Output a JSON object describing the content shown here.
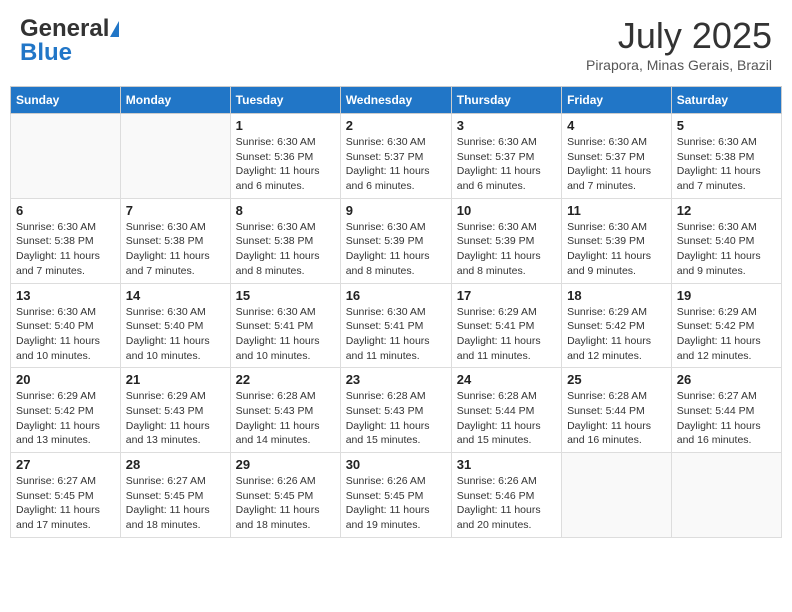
{
  "header": {
    "logo_general": "General",
    "logo_blue": "Blue",
    "month_title": "July 2025",
    "location": "Pirapora, Minas Gerais, Brazil"
  },
  "weekdays": [
    "Sunday",
    "Monday",
    "Tuesday",
    "Wednesday",
    "Thursday",
    "Friday",
    "Saturday"
  ],
  "weeks": [
    [
      {
        "day": "",
        "sunrise": "",
        "sunset": "",
        "daylight": ""
      },
      {
        "day": "",
        "sunrise": "",
        "sunset": "",
        "daylight": ""
      },
      {
        "day": "1",
        "sunrise": "Sunrise: 6:30 AM",
        "sunset": "Sunset: 5:36 PM",
        "daylight": "Daylight: 11 hours and 6 minutes."
      },
      {
        "day": "2",
        "sunrise": "Sunrise: 6:30 AM",
        "sunset": "Sunset: 5:37 PM",
        "daylight": "Daylight: 11 hours and 6 minutes."
      },
      {
        "day": "3",
        "sunrise": "Sunrise: 6:30 AM",
        "sunset": "Sunset: 5:37 PM",
        "daylight": "Daylight: 11 hours and 6 minutes."
      },
      {
        "day": "4",
        "sunrise": "Sunrise: 6:30 AM",
        "sunset": "Sunset: 5:37 PM",
        "daylight": "Daylight: 11 hours and 7 minutes."
      },
      {
        "day": "5",
        "sunrise": "Sunrise: 6:30 AM",
        "sunset": "Sunset: 5:38 PM",
        "daylight": "Daylight: 11 hours and 7 minutes."
      }
    ],
    [
      {
        "day": "6",
        "sunrise": "Sunrise: 6:30 AM",
        "sunset": "Sunset: 5:38 PM",
        "daylight": "Daylight: 11 hours and 7 minutes."
      },
      {
        "day": "7",
        "sunrise": "Sunrise: 6:30 AM",
        "sunset": "Sunset: 5:38 PM",
        "daylight": "Daylight: 11 hours and 7 minutes."
      },
      {
        "day": "8",
        "sunrise": "Sunrise: 6:30 AM",
        "sunset": "Sunset: 5:38 PM",
        "daylight": "Daylight: 11 hours and 8 minutes."
      },
      {
        "day": "9",
        "sunrise": "Sunrise: 6:30 AM",
        "sunset": "Sunset: 5:39 PM",
        "daylight": "Daylight: 11 hours and 8 minutes."
      },
      {
        "day": "10",
        "sunrise": "Sunrise: 6:30 AM",
        "sunset": "Sunset: 5:39 PM",
        "daylight": "Daylight: 11 hours and 8 minutes."
      },
      {
        "day": "11",
        "sunrise": "Sunrise: 6:30 AM",
        "sunset": "Sunset: 5:39 PM",
        "daylight": "Daylight: 11 hours and 9 minutes."
      },
      {
        "day": "12",
        "sunrise": "Sunrise: 6:30 AM",
        "sunset": "Sunset: 5:40 PM",
        "daylight": "Daylight: 11 hours and 9 minutes."
      }
    ],
    [
      {
        "day": "13",
        "sunrise": "Sunrise: 6:30 AM",
        "sunset": "Sunset: 5:40 PM",
        "daylight": "Daylight: 11 hours and 10 minutes."
      },
      {
        "day": "14",
        "sunrise": "Sunrise: 6:30 AM",
        "sunset": "Sunset: 5:40 PM",
        "daylight": "Daylight: 11 hours and 10 minutes."
      },
      {
        "day": "15",
        "sunrise": "Sunrise: 6:30 AM",
        "sunset": "Sunset: 5:41 PM",
        "daylight": "Daylight: 11 hours and 10 minutes."
      },
      {
        "day": "16",
        "sunrise": "Sunrise: 6:30 AM",
        "sunset": "Sunset: 5:41 PM",
        "daylight": "Daylight: 11 hours and 11 minutes."
      },
      {
        "day": "17",
        "sunrise": "Sunrise: 6:29 AM",
        "sunset": "Sunset: 5:41 PM",
        "daylight": "Daylight: 11 hours and 11 minutes."
      },
      {
        "day": "18",
        "sunrise": "Sunrise: 6:29 AM",
        "sunset": "Sunset: 5:42 PM",
        "daylight": "Daylight: 11 hours and 12 minutes."
      },
      {
        "day": "19",
        "sunrise": "Sunrise: 6:29 AM",
        "sunset": "Sunset: 5:42 PM",
        "daylight": "Daylight: 11 hours and 12 minutes."
      }
    ],
    [
      {
        "day": "20",
        "sunrise": "Sunrise: 6:29 AM",
        "sunset": "Sunset: 5:42 PM",
        "daylight": "Daylight: 11 hours and 13 minutes."
      },
      {
        "day": "21",
        "sunrise": "Sunrise: 6:29 AM",
        "sunset": "Sunset: 5:43 PM",
        "daylight": "Daylight: 11 hours and 13 minutes."
      },
      {
        "day": "22",
        "sunrise": "Sunrise: 6:28 AM",
        "sunset": "Sunset: 5:43 PM",
        "daylight": "Daylight: 11 hours and 14 minutes."
      },
      {
        "day": "23",
        "sunrise": "Sunrise: 6:28 AM",
        "sunset": "Sunset: 5:43 PM",
        "daylight": "Daylight: 11 hours and 15 minutes."
      },
      {
        "day": "24",
        "sunrise": "Sunrise: 6:28 AM",
        "sunset": "Sunset: 5:44 PM",
        "daylight": "Daylight: 11 hours and 15 minutes."
      },
      {
        "day": "25",
        "sunrise": "Sunrise: 6:28 AM",
        "sunset": "Sunset: 5:44 PM",
        "daylight": "Daylight: 11 hours and 16 minutes."
      },
      {
        "day": "26",
        "sunrise": "Sunrise: 6:27 AM",
        "sunset": "Sunset: 5:44 PM",
        "daylight": "Daylight: 11 hours and 16 minutes."
      }
    ],
    [
      {
        "day": "27",
        "sunrise": "Sunrise: 6:27 AM",
        "sunset": "Sunset: 5:45 PM",
        "daylight": "Daylight: 11 hours and 17 minutes."
      },
      {
        "day": "28",
        "sunrise": "Sunrise: 6:27 AM",
        "sunset": "Sunset: 5:45 PM",
        "daylight": "Daylight: 11 hours and 18 minutes."
      },
      {
        "day": "29",
        "sunrise": "Sunrise: 6:26 AM",
        "sunset": "Sunset: 5:45 PM",
        "daylight": "Daylight: 11 hours and 18 minutes."
      },
      {
        "day": "30",
        "sunrise": "Sunrise: 6:26 AM",
        "sunset": "Sunset: 5:45 PM",
        "daylight": "Daylight: 11 hours and 19 minutes."
      },
      {
        "day": "31",
        "sunrise": "Sunrise: 6:26 AM",
        "sunset": "Sunset: 5:46 PM",
        "daylight": "Daylight: 11 hours and 20 minutes."
      },
      {
        "day": "",
        "sunrise": "",
        "sunset": "",
        "daylight": ""
      },
      {
        "day": "",
        "sunrise": "",
        "sunset": "",
        "daylight": ""
      }
    ]
  ]
}
